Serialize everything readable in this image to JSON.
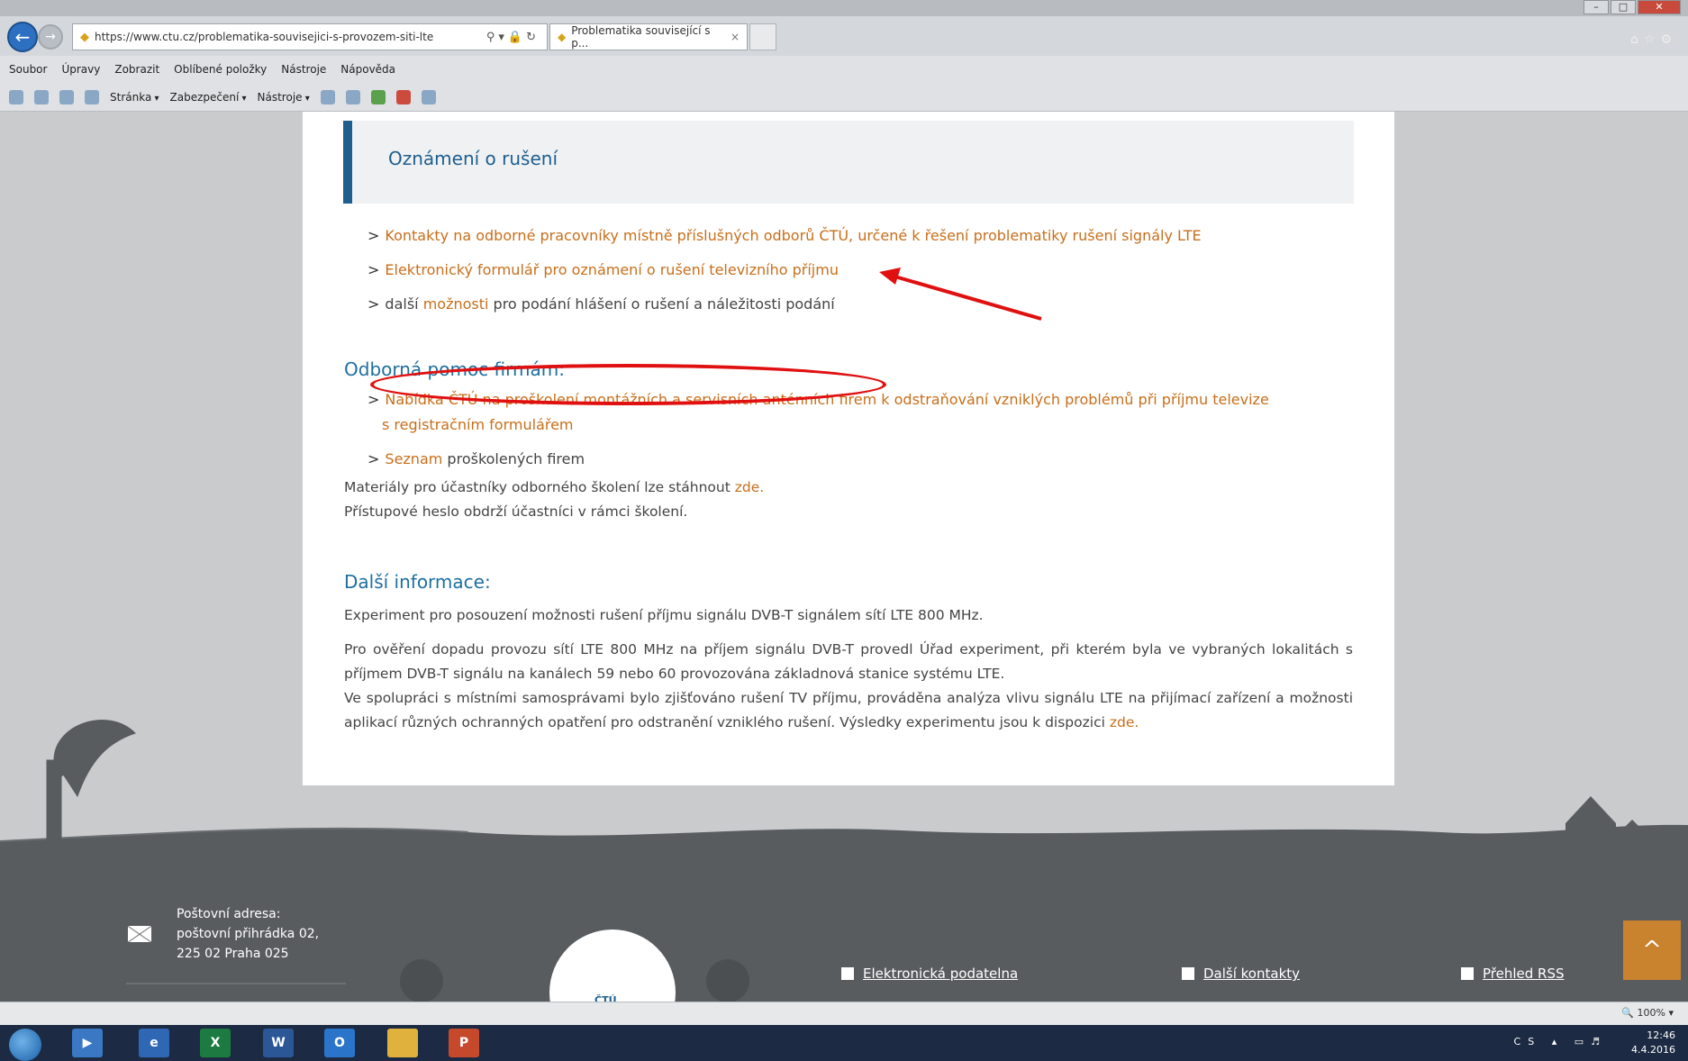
{
  "browser": {
    "url": "https://www.ctu.cz/problematika-souvisejici-s-provozem-siti-lte",
    "tab_title": "Problematika související s p...",
    "tab_close": "×",
    "menu": [
      "Soubor",
      "Úpravy",
      "Zobrazit",
      "Oblíbené položky",
      "Nástroje",
      "Nápověda"
    ],
    "commands": [
      "Stránka",
      "Zabezpečení",
      "Nástroje"
    ]
  },
  "page": {
    "notice_title": "Oznámení o rušení",
    "notice_links": [
      {
        "arrow": ">",
        "text": "Kontakty na odborné pracovníky místně příslušných odborů ČTÚ, určené k řešení problematiky rušení signály LTE"
      },
      {
        "arrow": ">",
        "text": "Elektronický formulář pro oznámení o rušení televizního příjmu"
      },
      {
        "arrow": ">",
        "pre": "další ",
        "link": "možnosti",
        "post": " pro podání hlášení o rušení a náležitosti podání"
      }
    ],
    "help_heading": "Odborná pomoc firmám:",
    "help_links": [
      {
        "arrow": ">",
        "line1": "Nabídka ČTÚ na proškolení montážních a servisních anténních firem k odstraňování vzniklých problémů při příjmu televize",
        "line2": "s registračním formulářem"
      },
      {
        "arrow": ">",
        "link": "Seznam",
        "post": " proškolených firem"
      }
    ],
    "materials_text": "Materiály pro účastníky odborného školení lze stáhnout ",
    "materials_link": "zde.",
    "password_text": "Přístupové heslo obdrží účastníci v rámci školení.",
    "info_heading": "Další informace:",
    "info_p1": "Experiment pro posouzení možnosti rušení příjmu signálu DVB-T signálem sítí LTE 800 MHz.",
    "info_p2": "Pro ověření dopadu provozu sítí LTE 800 MHz na příjem signálu DVB-T provedl Úřad experiment, při kterém byla ve vybraných lokalitách s příjmem DVB-T signálu na kanálech 59 nebo 60 provozována základnová stanice systému LTE.",
    "info_p3": "Ve spolupráci s místními samosprávami bylo zjišťováno rušení TV příjmu, prováděna analýza vlivu signálu LTE na přijímací zařízení a možnosti aplikací různých ochranných opatření pro odstranění vzniklého rušení. Výsledky experimentu jsou k dispozici ",
    "info_p3_link": "zde."
  },
  "footer": {
    "addr_label": "Poštovní adresa:",
    "addr_line1": "poštovní přihrádka 02,",
    "addr_line2": "225 02 Praha 025",
    "links": [
      "Elektronická podatelna",
      "Další kontakty",
      "Přehled RSS"
    ],
    "logo_text": "ČTÚ",
    "scroll_top": "^"
  },
  "status": {
    "zoom": "100%"
  },
  "taskbar": {
    "lang": "CS",
    "time": "12:46",
    "date": "4.4.2016",
    "apps": [
      "e",
      "X",
      "W",
      "O",
      "",
      "P"
    ]
  },
  "colors": {
    "accent": "#1e5f8e",
    "link": "#c86f1b",
    "annotation": "#e01010",
    "footer": "#595c5f"
  }
}
